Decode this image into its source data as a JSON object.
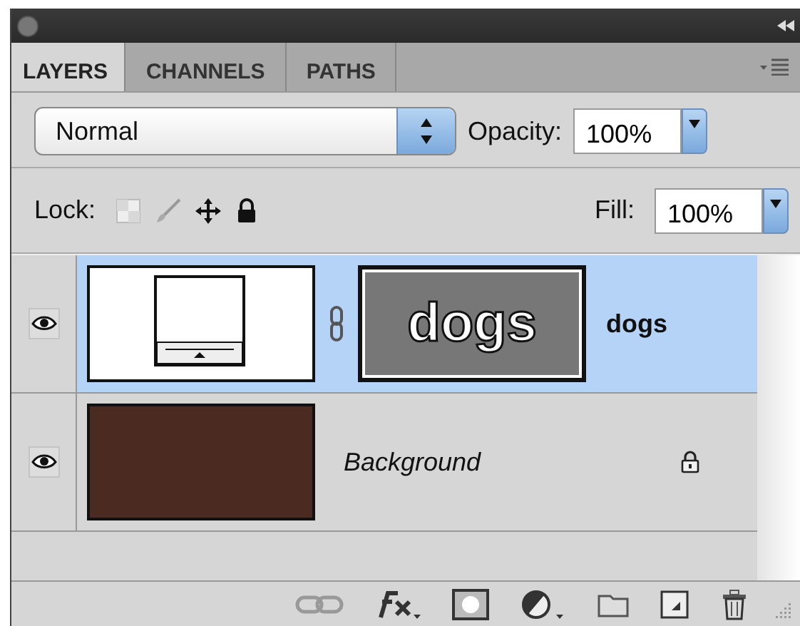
{
  "tabs": [
    {
      "label": "LAYERS",
      "selected": true
    },
    {
      "label": "CHANNELS",
      "selected": false
    },
    {
      "label": "PATHS",
      "selected": false
    }
  ],
  "blend_mode": {
    "value": "Normal"
  },
  "opacity": {
    "label": "Opacity:",
    "value": "100%"
  },
  "lock": {
    "label": "Lock:"
  },
  "fill": {
    "label": "Fill:",
    "value": "100%"
  },
  "layers": [
    {
      "name": "dogs",
      "kind": "text",
      "selected": true,
      "visible": true,
      "locked": false,
      "mask_text": "dogs"
    },
    {
      "name": "Background",
      "kind": "background",
      "selected": false,
      "visible": true,
      "locked": true,
      "color": "#4b2a22"
    }
  ]
}
